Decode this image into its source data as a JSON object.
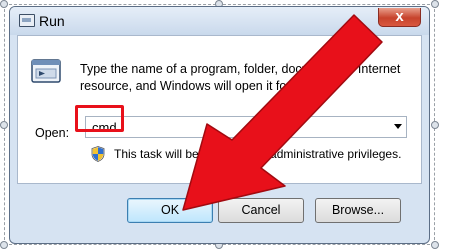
{
  "window": {
    "title": "Run",
    "close_label": "x"
  },
  "dialog": {
    "description_lines": [
      "Type the name of a program, folder, document, or Internet",
      "resource, and Windows will open it for you."
    ],
    "open_label": "Open:",
    "open_value": "cmd",
    "admin_note": "This task will be created with administrative privileges."
  },
  "buttons": {
    "ok": "OK",
    "cancel": "Cancel",
    "browse": "Browse..."
  },
  "icons": {
    "app": "run-app-icon",
    "program": "run-program-icon",
    "shield": "uac-shield-icon",
    "dropdown": "chevron-down-icon",
    "annotation": "red-arrow"
  },
  "colors": {
    "annotation_red": "#e8101a",
    "window_frame": "#d6e3f2",
    "ok_accent": "#3c7fb1"
  }
}
